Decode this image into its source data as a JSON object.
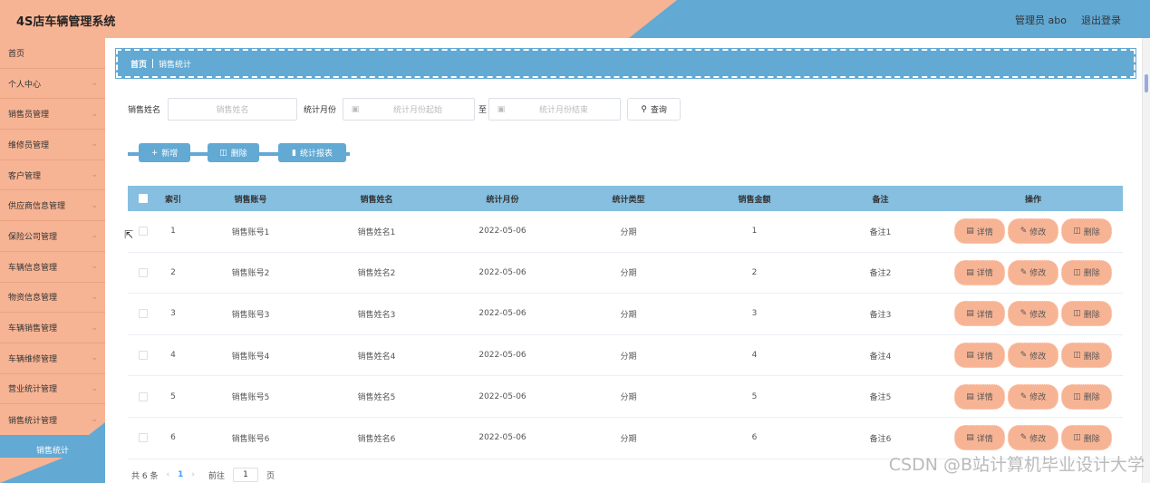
{
  "header": {
    "title": "4S店车辆管理系统",
    "user": "管理员 abo",
    "logout": "退出登录"
  },
  "sidebar": {
    "items": [
      {
        "label": "首页",
        "chevron": false
      },
      {
        "label": "个人中心",
        "chevron": true
      },
      {
        "label": "销售员管理",
        "chevron": true
      },
      {
        "label": "维修员管理",
        "chevron": true
      },
      {
        "label": "客户管理",
        "chevron": true
      },
      {
        "label": "供应商信息管理",
        "chevron": true
      },
      {
        "label": "保险公司管理",
        "chevron": true
      },
      {
        "label": "车辆信息管理",
        "chevron": true
      },
      {
        "label": "物资信息管理",
        "chevron": true
      },
      {
        "label": "车辆销售管理",
        "chevron": true
      },
      {
        "label": "车辆维修管理",
        "chevron": true
      },
      {
        "label": "营业统计管理",
        "chevron": true
      },
      {
        "label": "销售统计管理",
        "chevron": true
      }
    ],
    "active_sub": "销售统计"
  },
  "breadcrumb": {
    "home": "首页",
    "current": "销售统计"
  },
  "search": {
    "name_label": "销售姓名",
    "name_placeholder": "销售姓名",
    "month_label": "统计月份",
    "month_start_placeholder": "统计月份起始",
    "to_label": "至",
    "month_end_placeholder": "统计月份结束",
    "query_label": "查询"
  },
  "toolbar": {
    "add_label": "新增",
    "delete_label": "删除",
    "report_label": "统计报表"
  },
  "table": {
    "headers": {
      "index": "索引",
      "account": "销售账号",
      "name": "销售姓名",
      "month": "统计月份",
      "type": "统计类型",
      "amount": "销售金额",
      "note": "备注",
      "ops": "操作"
    },
    "ops": {
      "detail": "详情",
      "edit": "修改",
      "delete": "删除"
    },
    "rows": [
      {
        "index": "1",
        "account": "销售账号1",
        "name": "销售姓名1",
        "month": "2022-05-06",
        "type": "分期",
        "amount": "1",
        "note": "备注1"
      },
      {
        "index": "2",
        "account": "销售账号2",
        "name": "销售姓名2",
        "month": "2022-05-06",
        "type": "分期",
        "amount": "2",
        "note": "备注2"
      },
      {
        "index": "3",
        "account": "销售账号3",
        "name": "销售姓名3",
        "month": "2022-05-06",
        "type": "分期",
        "amount": "3",
        "note": "备注3"
      },
      {
        "index": "4",
        "account": "销售账号4",
        "name": "销售姓名4",
        "month": "2022-05-06",
        "type": "分期",
        "amount": "4",
        "note": "备注4"
      },
      {
        "index": "5",
        "account": "销售账号5",
        "name": "销售姓名5",
        "month": "2022-05-06",
        "type": "分期",
        "amount": "5",
        "note": "备注5"
      },
      {
        "index": "6",
        "account": "销售账号6",
        "name": "销售姓名6",
        "month": "2022-05-06",
        "type": "分期",
        "amount": "6",
        "note": "备注6"
      }
    ]
  },
  "pager": {
    "total": "共 6 条",
    "current_page": "1",
    "goto_label": "前往",
    "goto_value": "1",
    "page_unit": "页"
  },
  "watermark": "CSDN @B站计算机毕业设计大学",
  "colors": {
    "peach": "#f7b494",
    "blue": "#62a9d4",
    "header_row": "#86bfe0"
  }
}
